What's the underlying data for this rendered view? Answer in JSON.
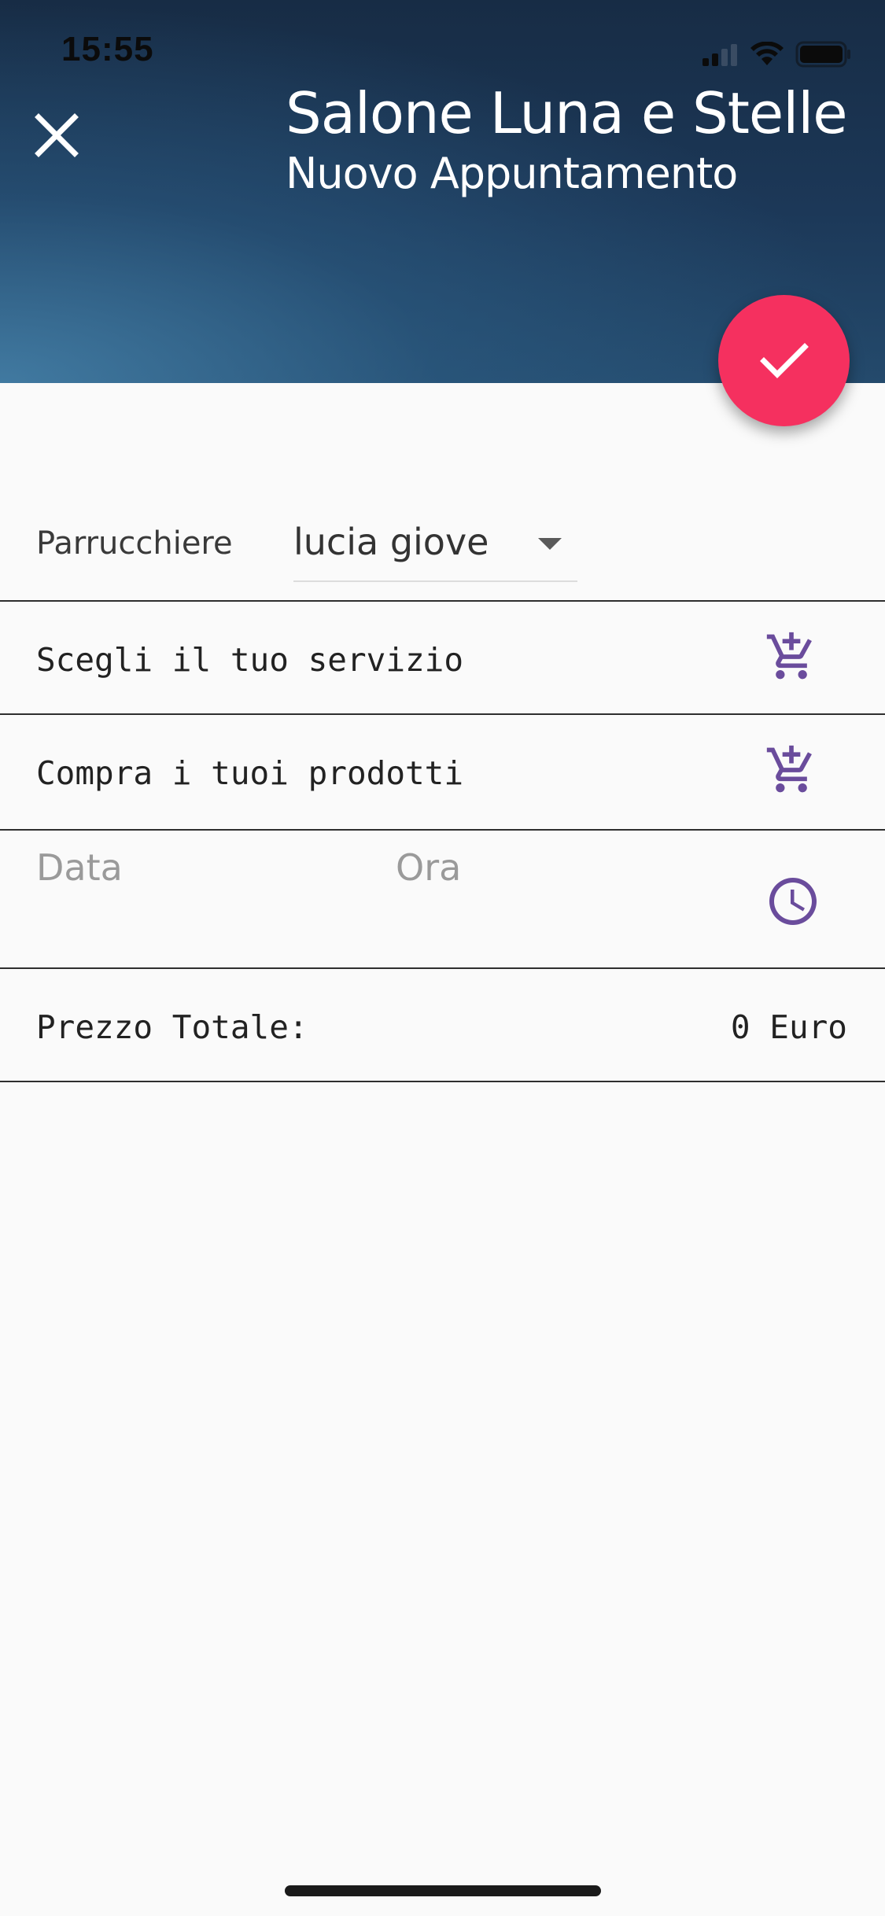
{
  "status_bar": {
    "time": "15:55"
  },
  "header": {
    "title": "Salone Luna e Stelle",
    "subtitle": "Nuovo Appuntamento",
    "close_icon": "close-icon",
    "confirm_icon": "check-icon"
  },
  "form": {
    "stylist_label": "Parrucchiere",
    "stylist_value": "lucia giove",
    "service_label": "Scegli il tuo servizio",
    "products_label": "Compra i tuoi prodotti",
    "date_placeholder": "Data",
    "time_placeholder": "Ora",
    "total_label": "Prezzo Totale:",
    "total_value": "0 Euro"
  },
  "colors": {
    "accent": "#f5305f",
    "icon_purple": "#6a4c9c",
    "header_dark": "#172c45"
  }
}
